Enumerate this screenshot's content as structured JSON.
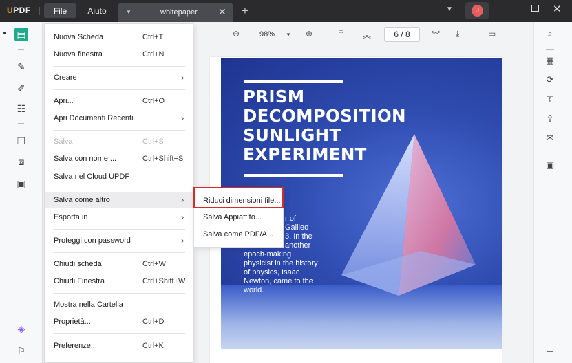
{
  "app": {
    "logo_u": "U",
    "logo_rest": "PDF",
    "avatar_initial": "J"
  },
  "menubar": {
    "file": "File",
    "help": "Aiuto"
  },
  "tab": {
    "name": "whitepaper"
  },
  "toolbar": {
    "zoom": "98%",
    "page": "6 / 8"
  },
  "file_menu": {
    "items": [
      {
        "label": "Nuova Scheda",
        "shortcut": "Ctrl+T"
      },
      {
        "label": "Nuova finestra",
        "shortcut": "Ctrl+N"
      },
      {
        "label": "Creare",
        "shortcut": ""
      },
      {
        "label": "Apri...",
        "shortcut": "Ctrl+O"
      },
      {
        "label": "Apri Documenti Recenti",
        "shortcut": ""
      },
      {
        "label": "Salva",
        "shortcut": "Ctrl+S",
        "disabled": true
      },
      {
        "label": "Salva con nome ...",
        "shortcut": "Ctrl+Shift+S"
      },
      {
        "label": "Salva nel Cloud UPDF",
        "shortcut": ""
      },
      {
        "label": "Salva come altro",
        "shortcut": ""
      },
      {
        "label": "Esporta in",
        "shortcut": ""
      },
      {
        "label": "Proteggi con password",
        "shortcut": ""
      },
      {
        "label": "Chiudi scheda",
        "shortcut": "Ctrl+W"
      },
      {
        "label": "Chiudi Finestra",
        "shortcut": "Ctrl+Shift+W"
      },
      {
        "label": "Mostra nella Cartella",
        "shortcut": ""
      },
      {
        "label": "Proprietà...",
        "shortcut": "Ctrl+D"
      },
      {
        "label": "Preferenze...",
        "shortcut": "Ctrl+K"
      }
    ]
  },
  "submenu": {
    "items": [
      {
        "label": "Riduci dimensioni file..."
      },
      {
        "label": "Salva Appiattito..."
      },
      {
        "label": "Salva come PDF/A..."
      }
    ]
  },
  "document": {
    "title_lines": [
      "PRISM",
      "DECOMPOSITION",
      "SUNLIGHT",
      "EXPERIMENT"
    ],
    "body_left": [
      "",
      "",
      "",
      "",
      "epoch-making",
      "physicist in the history",
      "of physics, Isaac",
      "Newton, came to the",
      "world."
    ],
    "body_right": [
      "r of",
      "Galileo",
      "3. In the",
      "another"
    ]
  }
}
